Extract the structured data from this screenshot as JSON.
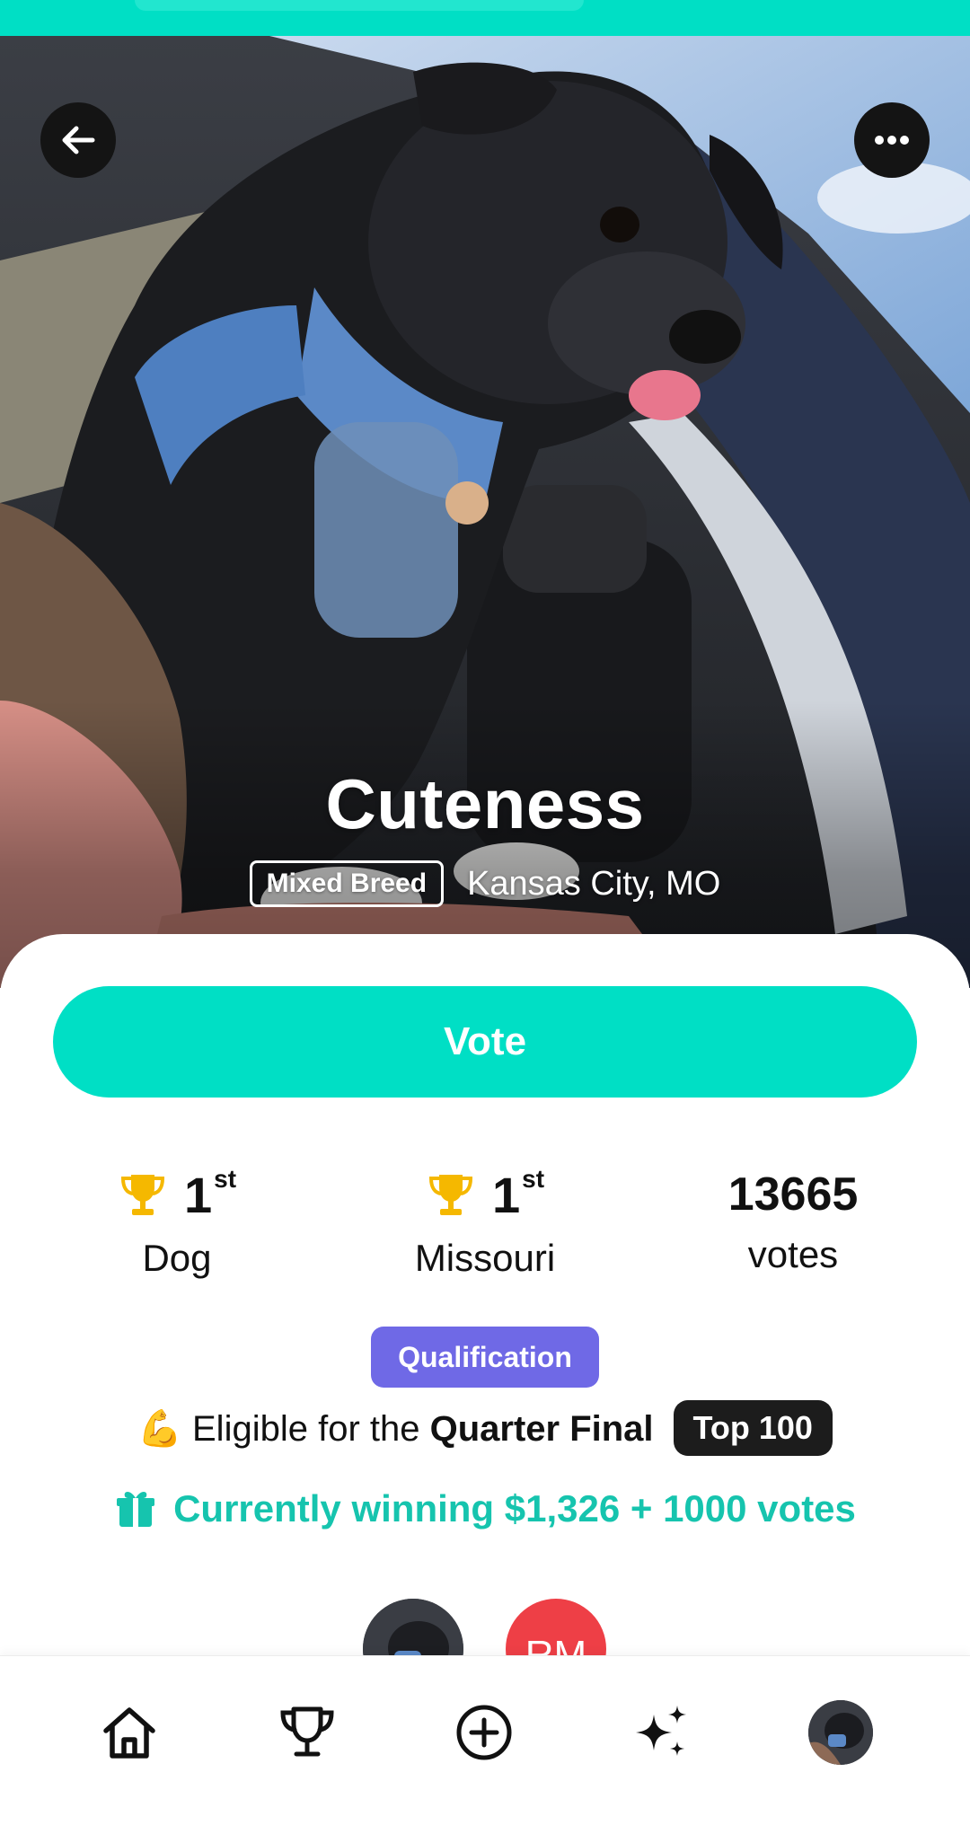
{
  "pet": {
    "name": "Cuteness",
    "breed": "Mixed Breed",
    "location": "Kansas City, MO"
  },
  "actions": {
    "vote_label": "Vote"
  },
  "stats": [
    {
      "rank": "1",
      "suffix": "st",
      "label": "Dog",
      "icon": "trophy-icon"
    },
    {
      "rank": "1",
      "suffix": "st",
      "label": "Missouri",
      "icon": "trophy-icon"
    },
    {
      "count": "13665",
      "label": "votes"
    }
  ],
  "qualification": {
    "badge": "Qualification",
    "emoji": "💪",
    "eligible_prefix": "Eligible for the ",
    "eligible_round": "Quarter Final",
    "top_badge": "Top 100"
  },
  "prize": {
    "icon": "gift-icon",
    "text": "Currently winning $1,326 + 1000 votes"
  },
  "voters": [
    {
      "type": "photo"
    },
    {
      "initials": "RM",
      "color": "#ee3f46"
    }
  ],
  "nav": {
    "items": [
      "home-icon",
      "trophy-icon",
      "add-circle-icon",
      "sparkle-icon",
      "profile-avatar"
    ]
  },
  "colors": {
    "accent": "#00dfc5",
    "qualification": "#6f69e6",
    "prize_text": "#16c4ae",
    "trophy": "#f5b800"
  }
}
